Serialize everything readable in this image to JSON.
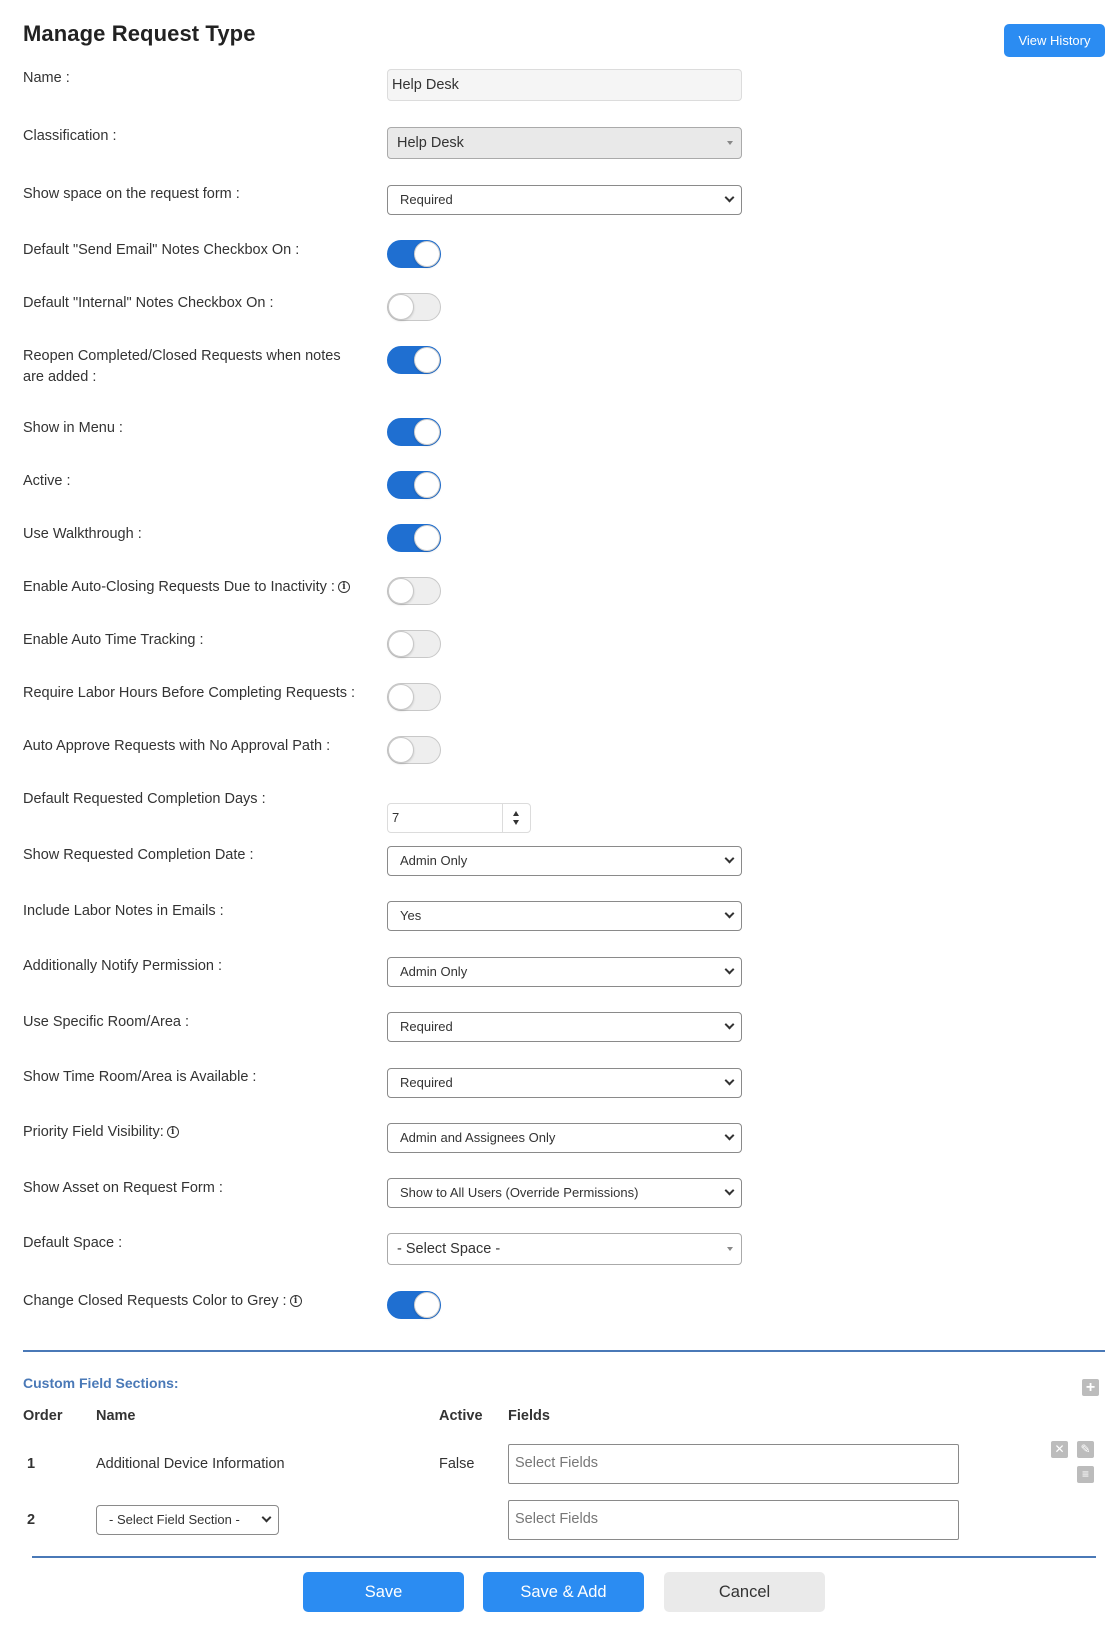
{
  "header": {
    "title": "Manage Request Type",
    "view_history_label": "View History"
  },
  "form": {
    "name": {
      "label": "Name :",
      "value": "Help Desk"
    },
    "classification": {
      "label": "Classification :",
      "value": "Help Desk"
    },
    "show_space": {
      "label": "Show space on the request form :",
      "value": "Required"
    },
    "send_email_default": {
      "label": "Default \"Send Email\" Notes Checkbox On :",
      "on": true
    },
    "internal_default": {
      "label": "Default \"Internal\" Notes Checkbox On :",
      "on": false
    },
    "reopen": {
      "label": "Reopen Completed/Closed Requests when notes are added :",
      "on": true
    },
    "show_in_menu": {
      "label": "Show in Menu :",
      "on": true
    },
    "active": {
      "label": "Active :",
      "on": true
    },
    "walkthrough": {
      "label": "Use Walkthrough :",
      "on": true
    },
    "auto_closing": {
      "label": "Enable Auto-Closing Requests Due to Inactivity :",
      "on": false
    },
    "auto_time": {
      "label": "Enable Auto Time Tracking :",
      "on": false
    },
    "labor_hours": {
      "label": "Require Labor Hours Before Completing Requests :",
      "on": false
    },
    "auto_approve": {
      "label": "Auto Approve Requests with No Approval Path :",
      "on": false
    },
    "completion_days": {
      "label": "Default Requested Completion Days :",
      "value": "7"
    },
    "completion_date": {
      "label": "Show Requested Completion Date :",
      "value": "Admin Only"
    },
    "labor_notes": {
      "label": "Include Labor Notes in Emails :",
      "value": "Yes"
    },
    "notify_permission": {
      "label": "Additionally Notify Permission :",
      "value": "Admin Only"
    },
    "room_area": {
      "label": "Use Specific Room/Area :",
      "value": "Required"
    },
    "time_room": {
      "label": "Show Time Room/Area is Available :",
      "value": "Required"
    },
    "priority_visibility": {
      "label": "Priority Field Visibility:",
      "value": "Admin and Assignees Only"
    },
    "show_asset": {
      "label": "Show Asset on Request Form :",
      "value": "Show to All Users (Override Permissions)"
    },
    "default_space": {
      "label": "Default Space :",
      "value": "- Select Space -"
    },
    "grey_closed": {
      "label": "Change Closed Requests Color to Grey :",
      "on": true
    }
  },
  "custom_sections": {
    "title": "Custom Field Sections:",
    "columns": [
      "Order",
      "Name",
      "Active",
      "Fields"
    ],
    "rows": [
      {
        "order": "1",
        "name": "Additional Device Information",
        "active": "False",
        "fields_placeholder": "Select Fields"
      },
      {
        "order": "2",
        "name_select": "- Select Field Section -",
        "fields_placeholder": "Select Fields"
      }
    ]
  },
  "footer": {
    "save": "Save",
    "save_add": "Save & Add",
    "cancel": "Cancel"
  },
  "colors": {
    "primary": "#2b8cf2",
    "toggle_on": "#1f6fd1",
    "section_accent": "#4a79b7"
  },
  "icons": [
    "info-icon",
    "plus-icon",
    "close-icon",
    "edit-icon",
    "list-icon",
    "chevron-down-icon"
  ]
}
